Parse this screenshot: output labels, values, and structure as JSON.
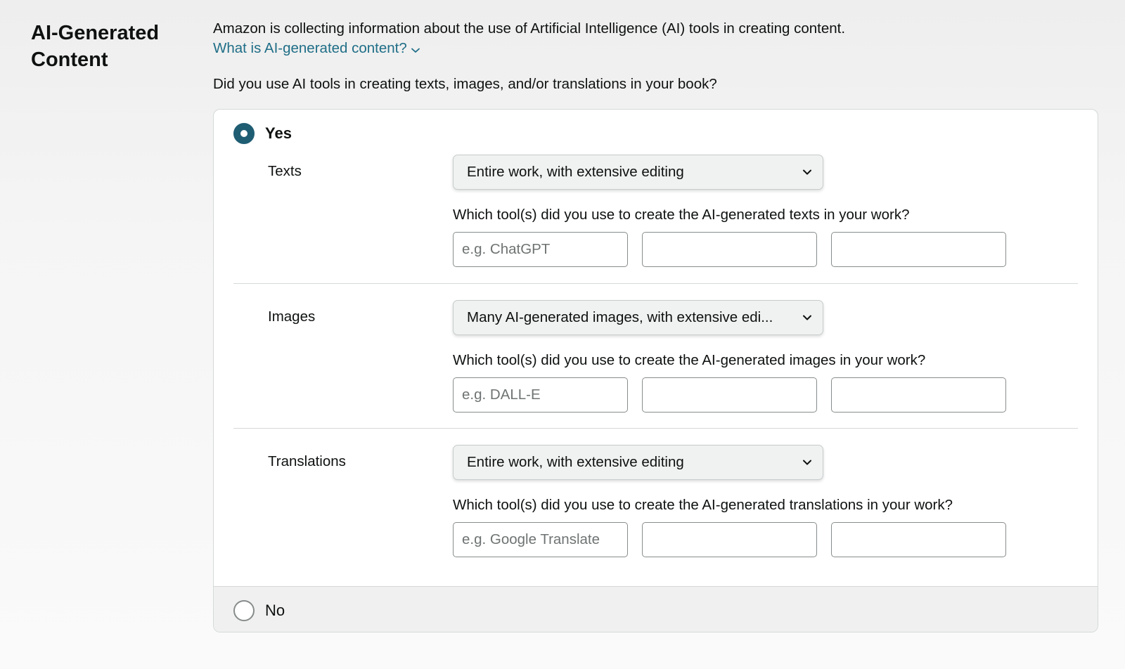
{
  "section": {
    "title": "AI-Generated Content"
  },
  "intro": {
    "text": "Amazon is collecting information about the use of Artificial Intelligence (AI) tools in creating content.",
    "link_label": "What is AI-generated content?"
  },
  "question": "Did you use AI tools in creating texts, images, and/or translations in your book?",
  "options": {
    "yes_label": "Yes",
    "no_label": "No",
    "selected": "Yes"
  },
  "rows": [
    {
      "label": "Texts",
      "select_value": "Entire work, with extensive editing",
      "tool_question": "Which tool(s) did you use to create the AI-generated texts in your work?",
      "inputs": [
        {
          "value": "",
          "placeholder": "e.g. ChatGPT"
        },
        {
          "value": "",
          "placeholder": ""
        },
        {
          "value": "",
          "placeholder": ""
        }
      ]
    },
    {
      "label": "Images",
      "select_value": "Many AI-generated images, with extensive edi...",
      "tool_question": "Which tool(s) did you use to create the AI-generated images in your work?",
      "inputs": [
        {
          "value": "",
          "placeholder": "e.g. DALL-E"
        },
        {
          "value": "",
          "placeholder": ""
        },
        {
          "value": "",
          "placeholder": ""
        }
      ]
    },
    {
      "label": "Translations",
      "select_value": "Entire work, with extensive editing",
      "tool_question": "Which tool(s) did you use to create the AI-generated translations in your work?",
      "inputs": [
        {
          "value": "",
          "placeholder": "e.g. Google Translate"
        },
        {
          "value": "",
          "placeholder": ""
        },
        {
          "value": "",
          "placeholder": ""
        }
      ]
    }
  ],
  "icons": {
    "link_chevron": "chevron-down-icon",
    "select_chevron": "chevron-down-icon"
  },
  "colors": {
    "link": "#1f6e87",
    "radio_selected": "#1f5d73",
    "select_background": "#f0f2f2",
    "no_band_background": "#f0f0f0"
  }
}
